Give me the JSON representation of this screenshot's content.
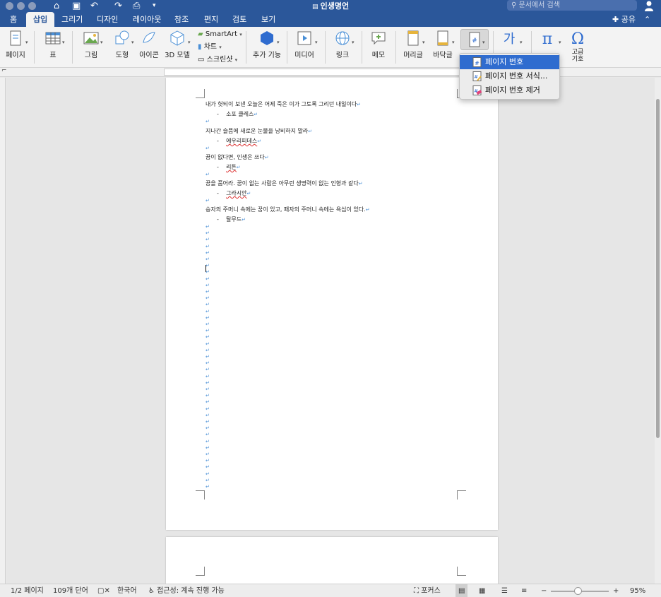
{
  "window": {
    "title": "인생명언",
    "search_placeholder": "문서에서 검색"
  },
  "tabs": [
    "홈",
    "삽입",
    "그리기",
    "디자인",
    "레이아웃",
    "참조",
    "편지",
    "검토",
    "보기"
  ],
  "active_tab": "삽입",
  "share_label": "공유",
  "ribbon": {
    "page": "페이지",
    "table": "표",
    "picture": "그림",
    "shape": "도형",
    "icon": "아이콘",
    "model3d": "3D 모델",
    "smartart": "SmartArt",
    "chart": "차트",
    "screenshot": "스크린샷",
    "addin": "추가 기능",
    "media": "미디어",
    "link": "링크",
    "comment": "메모",
    "header": "머리글",
    "footer": "바닥글",
    "symbol_advanced": "고급\n기호",
    "symbol_line1": "고급",
    "symbol_line2": "기호"
  },
  "page_number_menu": {
    "items": [
      "페이지 번호",
      "페이지 번호 서식...",
      "페이지 번호 제거"
    ],
    "selected_index": 0
  },
  "document": {
    "lines": [
      {
        "text": "내가 헛되이 보낸 오늘은 어제 죽은 이가 그토록 그리던 내일이다"
      },
      {
        "bullet": "-",
        "text": "소포 클레스"
      },
      {
        "text": "지나간 슬픔에 새로운 눈물을 낭비하지 말라"
      },
      {
        "bullet": "-",
        "text": "에우리피데스"
      },
      {
        "text": "꿈이 없다면, 인생은 쓰다"
      },
      {
        "bullet": "-",
        "text": "리튼"
      },
      {
        "text": "꿈을 품어라. 꿈이 없는 사람은 아무런 생명력이 없는 인형과 같다"
      },
      {
        "bullet": "-",
        "text": "그라시안"
      },
      {
        "text": "승자의 주머니 속에는 꿈이 있고, 패자의 주머니 속에는 욕심이 있다."
      },
      {
        "bullet": "-",
        "text": "탈무드"
      }
    ]
  },
  "status": {
    "page": "1/2 페이지",
    "words": "109개 단어",
    "language": "한국어",
    "accessibility": "접근성: 계속 진행 가능",
    "focus": "포커스",
    "zoom": "95%"
  }
}
